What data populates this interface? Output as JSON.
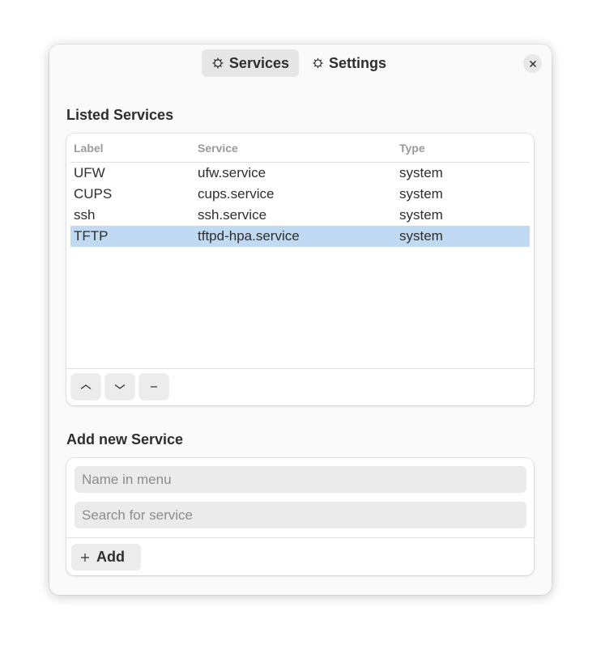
{
  "tabs": [
    {
      "label": "Services",
      "icon": "gear-icon",
      "active": true
    },
    {
      "label": "Settings",
      "icon": "gear-icon",
      "active": false
    }
  ],
  "listed": {
    "title": "Listed Services",
    "columns": [
      "Label",
      "Service",
      "Type"
    ],
    "rows": [
      {
        "label": "UFW",
        "service": "ufw.service",
        "type": "system"
      },
      {
        "label": "CUPS",
        "service": "cups.service",
        "type": "system"
      },
      {
        "label": "ssh",
        "service": "ssh.service",
        "type": "system"
      },
      {
        "label": "TFTP",
        "service": "tftpd-hpa.service",
        "type": "system",
        "selected": true
      }
    ],
    "buttons": [
      "move-up-icon",
      "move-down-icon",
      "remove-icon"
    ]
  },
  "add_section": {
    "title": "Add new Service",
    "name_placeholder": "Name in menu",
    "search_placeholder": "Search for service",
    "add_label": "Add"
  },
  "colors": {
    "selection": "#c0daf3",
    "window_bg": "#fafafa",
    "field_bg": "#ebebeb"
  }
}
